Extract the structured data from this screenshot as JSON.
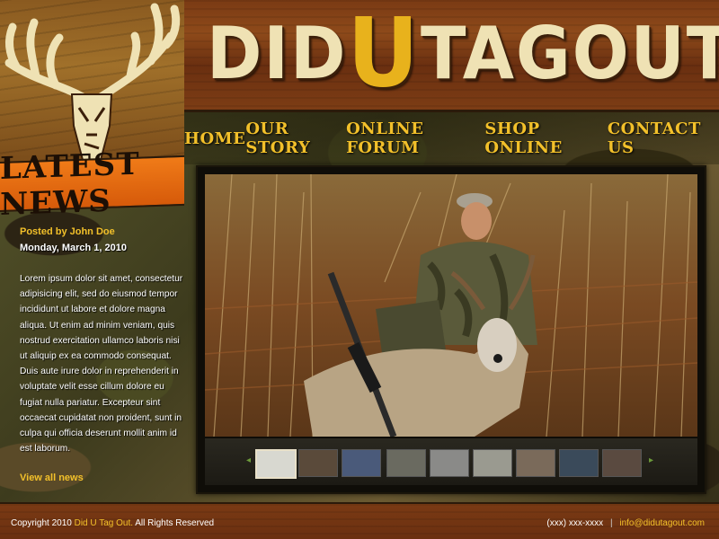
{
  "site": {
    "title_word_1": "DID",
    "title_word_2": "U",
    "title_word_3": "TAG",
    "title_word_4": "OUT",
    "latest_news_label": "LATEST NEWS"
  },
  "nav": {
    "items": [
      {
        "label": "HOME"
      },
      {
        "label": "OUR STORY"
      },
      {
        "label": "ONLINE FORUM"
      },
      {
        "label": "SHOP ONLINE"
      },
      {
        "label": "CONTACT US"
      }
    ]
  },
  "news": {
    "author": "Posted by John Doe",
    "date": "Monday, March 1, 2010",
    "body": "Lorem ipsum dolor sit amet, consectetur adipisicing elit, sed do eiusmod tempor incididunt ut labore et dolore magna aliqua. Ut enim ad minim veniam, quis nostrud exercitation ullamco laboris nisi ut aliquip ex ea commodo consequat. Duis aute irure dolor in reprehenderit in voluptate velit esse cillum dolore eu fugiat nulla pariatur. Excepteur sint occaecat cupidatat non proident, sunt in culpa qui officia deserunt mollit anim id est laborum.",
    "view_all": "View all news"
  },
  "gallery": {
    "thumb_count": 9,
    "active_thumb": 1,
    "thumb_colors": [
      "#d8d8d0",
      "#5a4a3a",
      "#4a5a7a",
      "#6a6a60",
      "#8a8a88",
      "#9a9a90",
      "#7a6a5a",
      "#3a4a5a",
      "#5a4a40"
    ]
  },
  "footer": {
    "copyright_prefix": "Copyright 2010",
    "site_name": "Did U Tag Out.",
    "rights": "All Rights Reserved",
    "phone": "(xxx) xxx-xxxx",
    "separator": "|",
    "email": "info@didutagout.com"
  },
  "colors": {
    "accent_gold": "#f2c02a",
    "wood": "#7a3a14",
    "banner_orange": "#f07b18"
  }
}
